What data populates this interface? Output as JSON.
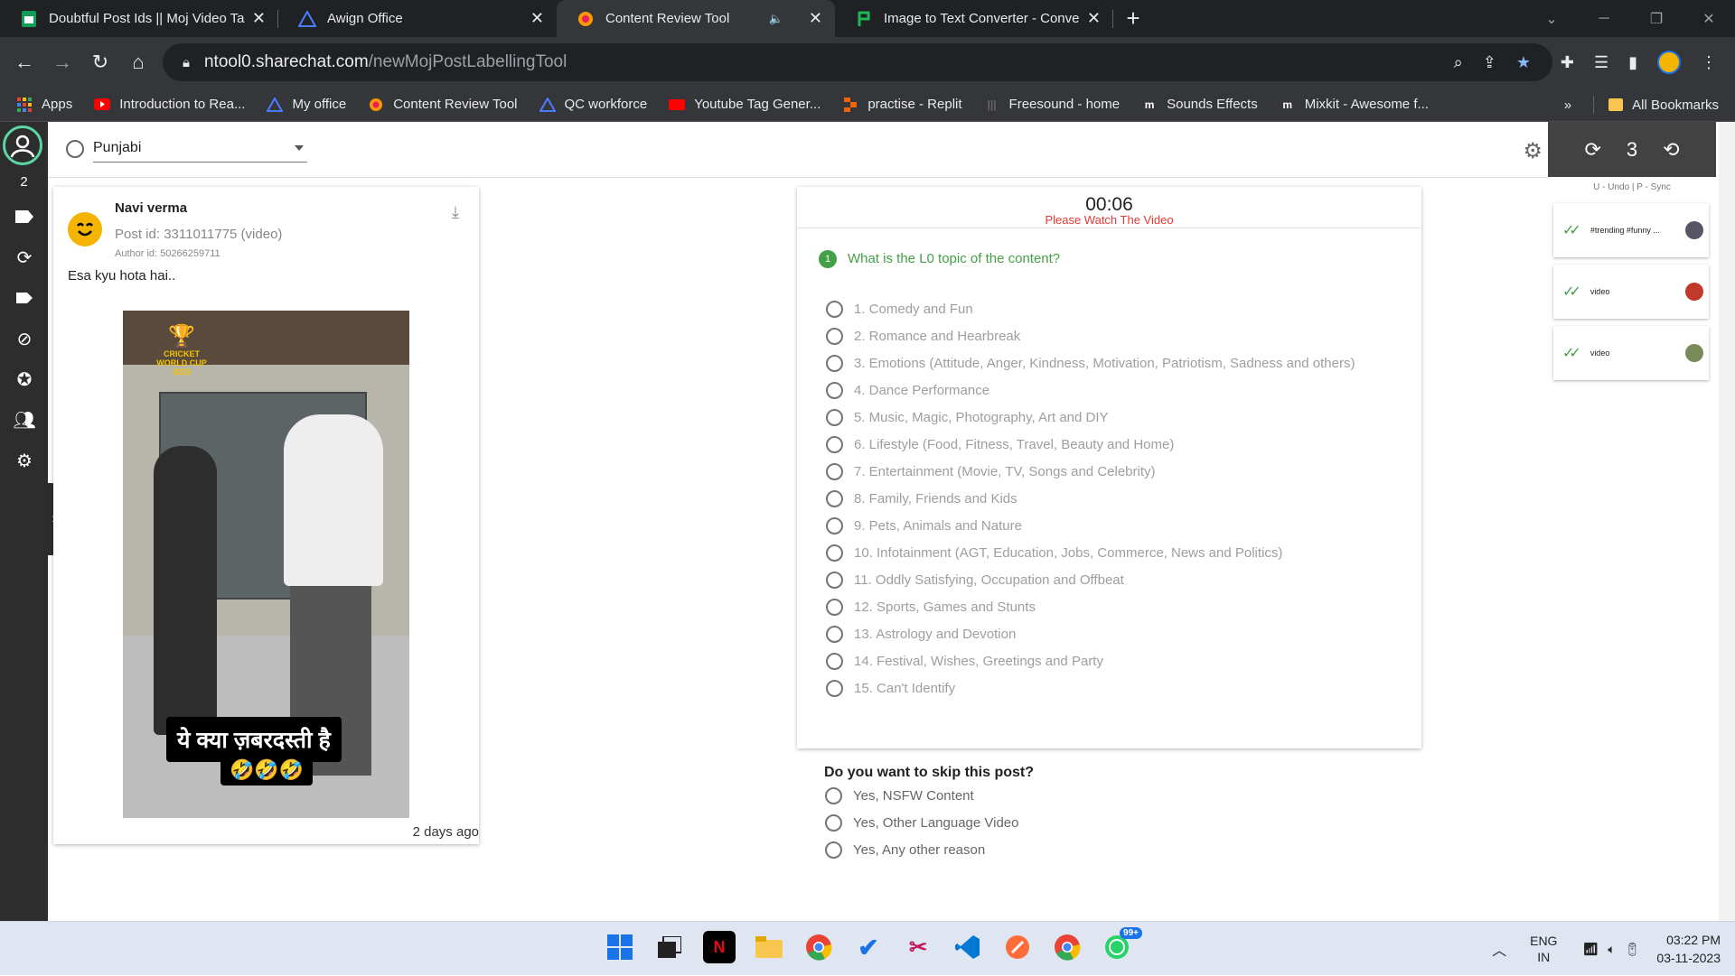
{
  "browser": {
    "tabs": [
      {
        "title": "Doubtful Post Ids || Moj Video Ta",
        "icon": "sheets-icon",
        "active": false
      },
      {
        "title": "Awign Office",
        "icon": "awign-icon",
        "active": false
      },
      {
        "title": "Content Review Tool",
        "icon": "sharechat-icon",
        "active": true
      },
      {
        "title": "Image to Text Converter - Conve",
        "icon": "converter-icon",
        "active": false
      }
    ],
    "close_glyph": "✕",
    "new_tab_glyph": "+",
    "url_host": "ntool0.sharechat.com",
    "url_path": "/newMojPostLabellingTool",
    "bookmarks": [
      {
        "label": "Apps",
        "icon": "apps-grid-icon"
      },
      {
        "label": "Introduction to Rea...",
        "icon": "youtube-icon"
      },
      {
        "label": "My office",
        "icon": "awign-icon"
      },
      {
        "label": "Content Review Tool",
        "icon": "sharechat-icon"
      },
      {
        "label": "QC workforce",
        "icon": "awign-icon"
      },
      {
        "label": "Youtube Tag Gener...",
        "icon": "youtube-tag-icon"
      },
      {
        "label": "practise - Replit",
        "icon": "replit-icon"
      },
      {
        "label": "Freesound - home",
        "icon": "freesound-icon"
      },
      {
        "label": "Sounds Effects",
        "icon": "mixkit-icon"
      },
      {
        "label": "Mixkit - Awesome f...",
        "icon": "mixkit-icon"
      }
    ],
    "bookmarks_more": "»",
    "all_bookmarks": "All Bookmarks"
  },
  "sidebar": {
    "count": "2",
    "expand_glyph": "›"
  },
  "toolbar": {
    "language": "Punjabi"
  },
  "post": {
    "author": "Navi verma",
    "post_id": "Post id: 3311011775 (video)",
    "author_id": "Author id: 50266259711",
    "caption": "Esa kyu hota hai..",
    "video_overlay_text": "ये क्या ज़बरदस्ती है",
    "video_emojis": "🤣🤣🤣",
    "trophy_text": "CRICKET WORLD CUP 2023",
    "time_ago": "2 days ago"
  },
  "question": {
    "timer": "00:06",
    "warning": "Please Watch The Video",
    "number": "1",
    "title": "What is the L0 topic of the content?",
    "options": [
      "1. Comedy and Fun",
      "2. Romance and Hearbreak",
      "3. Emotions (Attitude, Anger, Kindness, Motivation, Patriotism, Sadness and others)",
      "4. Dance Performance",
      "5. Music, Magic, Photography, Art and DIY",
      "6. Lifestyle (Food, Fitness, Travel, Beauty and Home)",
      "7. Entertainment (Movie, TV, Songs and Celebrity)",
      "8. Family, Friends and Kids",
      "9. Pets, Animals and Nature",
      "10. Infotainment (AGT, Education, Jobs, Commerce, News and Politics)",
      "11. Oddly Satisfying, Occupation and Offbeat",
      "12. Sports, Games and Stunts",
      "13. Astrology and Devotion",
      "14. Festival, Wishes, Greetings and Party",
      "15. Can't Identify"
    ]
  },
  "skip": {
    "title": "Do you want to skip this post?",
    "options": [
      "Yes, NSFW Content",
      "Yes, Other Language Video",
      "Yes, Any other reason"
    ]
  },
  "history": {
    "count": "3",
    "hint": "U - Undo | P - Sync",
    "items": [
      {
        "text": "#trending #funny ..."
      },
      {
        "text": "video"
      },
      {
        "text": "video"
      }
    ]
  },
  "taskbar": {
    "badge": "99+",
    "lang_line1": "ENG",
    "lang_line2": "IN",
    "time": "03:22 PM",
    "date": "03-11-2023"
  },
  "colors": {
    "accent_green": "#43a047",
    "warning_red": "#e53935",
    "sidebar_dark": "#2d2d2d",
    "chrome_dark": "#202124"
  }
}
